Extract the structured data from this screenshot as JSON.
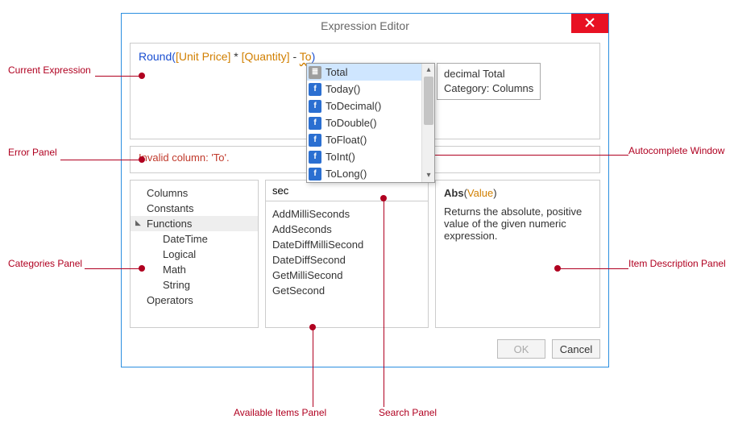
{
  "dialog": {
    "title": "Expression Editor",
    "expression": {
      "func": "Round",
      "open": "(",
      "field1": "[Unit Price]",
      "op1": " * ",
      "field2": "[Quantity]",
      "op2": " - ",
      "partial": "To",
      "close": ")"
    },
    "error": "Invalid column: 'To'.",
    "buttons": {
      "ok": "OK",
      "cancel": "Cancel"
    }
  },
  "autocomplete": {
    "items": [
      {
        "label": "Total",
        "kind": "col",
        "selected": true
      },
      {
        "label": "Today()",
        "kind": "fn"
      },
      {
        "label": "ToDecimal()",
        "kind": "fn"
      },
      {
        "label": "ToDouble()",
        "kind": "fn"
      },
      {
        "label": "ToFloat()",
        "kind": "fn"
      },
      {
        "label": "ToInt()",
        "kind": "fn"
      },
      {
        "label": "ToLong()",
        "kind": "fn"
      }
    ],
    "tooltip": {
      "line1": "decimal Total",
      "line2": "Category: Columns"
    }
  },
  "categories": [
    {
      "label": "Columns",
      "depth": 0
    },
    {
      "label": "Constants",
      "depth": 0
    },
    {
      "label": "Functions",
      "depth": 0,
      "selected": true
    },
    {
      "label": "DateTime",
      "depth": 1
    },
    {
      "label": "Logical",
      "depth": 1
    },
    {
      "label": "Math",
      "depth": 1
    },
    {
      "label": "String",
      "depth": 1
    },
    {
      "label": "Operators",
      "depth": 0
    }
  ],
  "search": {
    "value": "sec"
  },
  "items": [
    "AddMilliSeconds",
    "AddSeconds",
    "DateDiffMilliSecond",
    "DateDiffSecond",
    "GetMilliSecond",
    "GetSecond"
  ],
  "description": {
    "sig_name": "Abs",
    "sig_open": "(",
    "sig_arg": "Value",
    "sig_close": ")",
    "text": "Returns the absolute, positive value of the given numeric expression."
  },
  "callouts": {
    "currentExpression": "Current Expression",
    "errorPanel": "Error Panel",
    "categoriesPanel": "Categories Panel",
    "autocompleteWindow": "Autocomplete Window",
    "itemDescPanel": "Item Description Panel",
    "availableItems": "Available Items Panel",
    "searchPanel": "Search Panel"
  }
}
